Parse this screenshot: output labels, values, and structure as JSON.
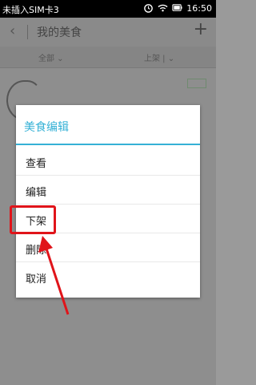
{
  "status_bar": {
    "carrier": "未插入SIM卡3",
    "time": "16:50",
    "icons": [
      "alarm-icon",
      "wifi-icon",
      "battery-icon"
    ]
  },
  "header": {
    "back_icon": "back-arrow-icon",
    "title": "我的美食",
    "add_icon": "plus-icon"
  },
  "filters": {
    "left": "全部 ⌄",
    "right": "上架 | ⌄"
  },
  "dialog": {
    "title": "美食编辑",
    "items": [
      "查看",
      "编辑",
      "下架",
      "删除",
      "取消"
    ]
  },
  "colors": {
    "accent": "#35b1d6",
    "annotation": "#e0141a"
  }
}
